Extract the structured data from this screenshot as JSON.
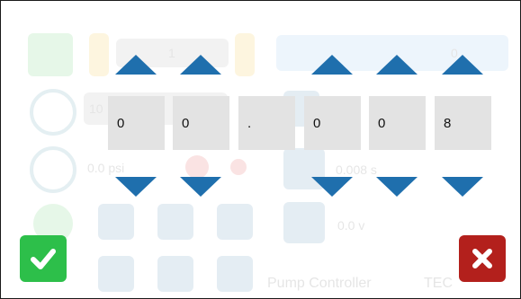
{
  "background_screen": {
    "index_value": "1",
    "number_value": "0",
    "row1_value": "10",
    "pressure_value": "0.0 psi",
    "flow_value": "0.008 s",
    "voltage_value": "0.0 v",
    "footer_title": "Pump Controller",
    "brand": "TEC"
  },
  "stepper": {
    "digits": [
      "0",
      "0",
      ".",
      "0",
      "0",
      "8"
    ]
  },
  "actions": {
    "confirm_icon": "check-icon",
    "cancel_icon": "close-icon"
  },
  "colors": {
    "arrow": "#1f6fad",
    "confirm": "#2dbf4a",
    "cancel": "#b3201c",
    "digit_bg": "#e3e3e3"
  }
}
